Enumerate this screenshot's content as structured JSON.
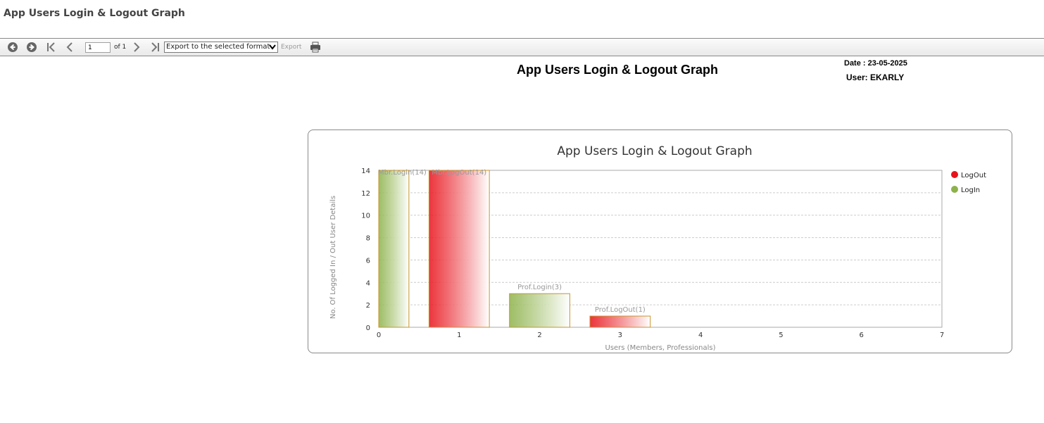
{
  "page": {
    "title": "App Users Login & Logout Graph"
  },
  "toolbar": {
    "page_value": "1",
    "page_of": "of 1",
    "export_format_selected": "Export to the selected format",
    "export_label": "Export",
    "icons": [
      "back-circle-icon",
      "forward-circle-icon",
      "first-page-icon",
      "previous-page-icon",
      "next-page-icon",
      "last-page-icon",
      "print-icon"
    ]
  },
  "report": {
    "title": "App Users Login & Logout Graph",
    "date": "Date : 23-05-2025",
    "user": "User: EKARLY"
  },
  "chart_data": {
    "type": "bar",
    "title": "App Users Login & Logout Graph",
    "xlabel": "Users (Members, Professionals)",
    "ylabel": "No. Of Logged In / Out User Details",
    "xlim": [
      0,
      7
    ],
    "ylim": [
      0,
      14
    ],
    "xticks": [
      0,
      1,
      2,
      3,
      4,
      5,
      6,
      7
    ],
    "yticks": [
      0,
      2,
      4,
      6,
      8,
      10,
      12,
      14
    ],
    "grid": true,
    "legend_position": "right",
    "series": [
      {
        "name": "LogOut",
        "color": "#e8121b",
        "points": [
          {
            "x": 1,
            "y": 14,
            "label": "Mbr.LogOut(14)"
          },
          {
            "x": 3,
            "y": 1,
            "label": "Prof.LogOut(1)"
          }
        ]
      },
      {
        "name": "LogIn",
        "color": "#8db24a",
        "points": [
          {
            "x": 0,
            "y": 14,
            "label": "Mbr.Login(14)"
          },
          {
            "x": 2,
            "y": 3,
            "label": "Prof.Login(3)"
          }
        ]
      }
    ]
  }
}
